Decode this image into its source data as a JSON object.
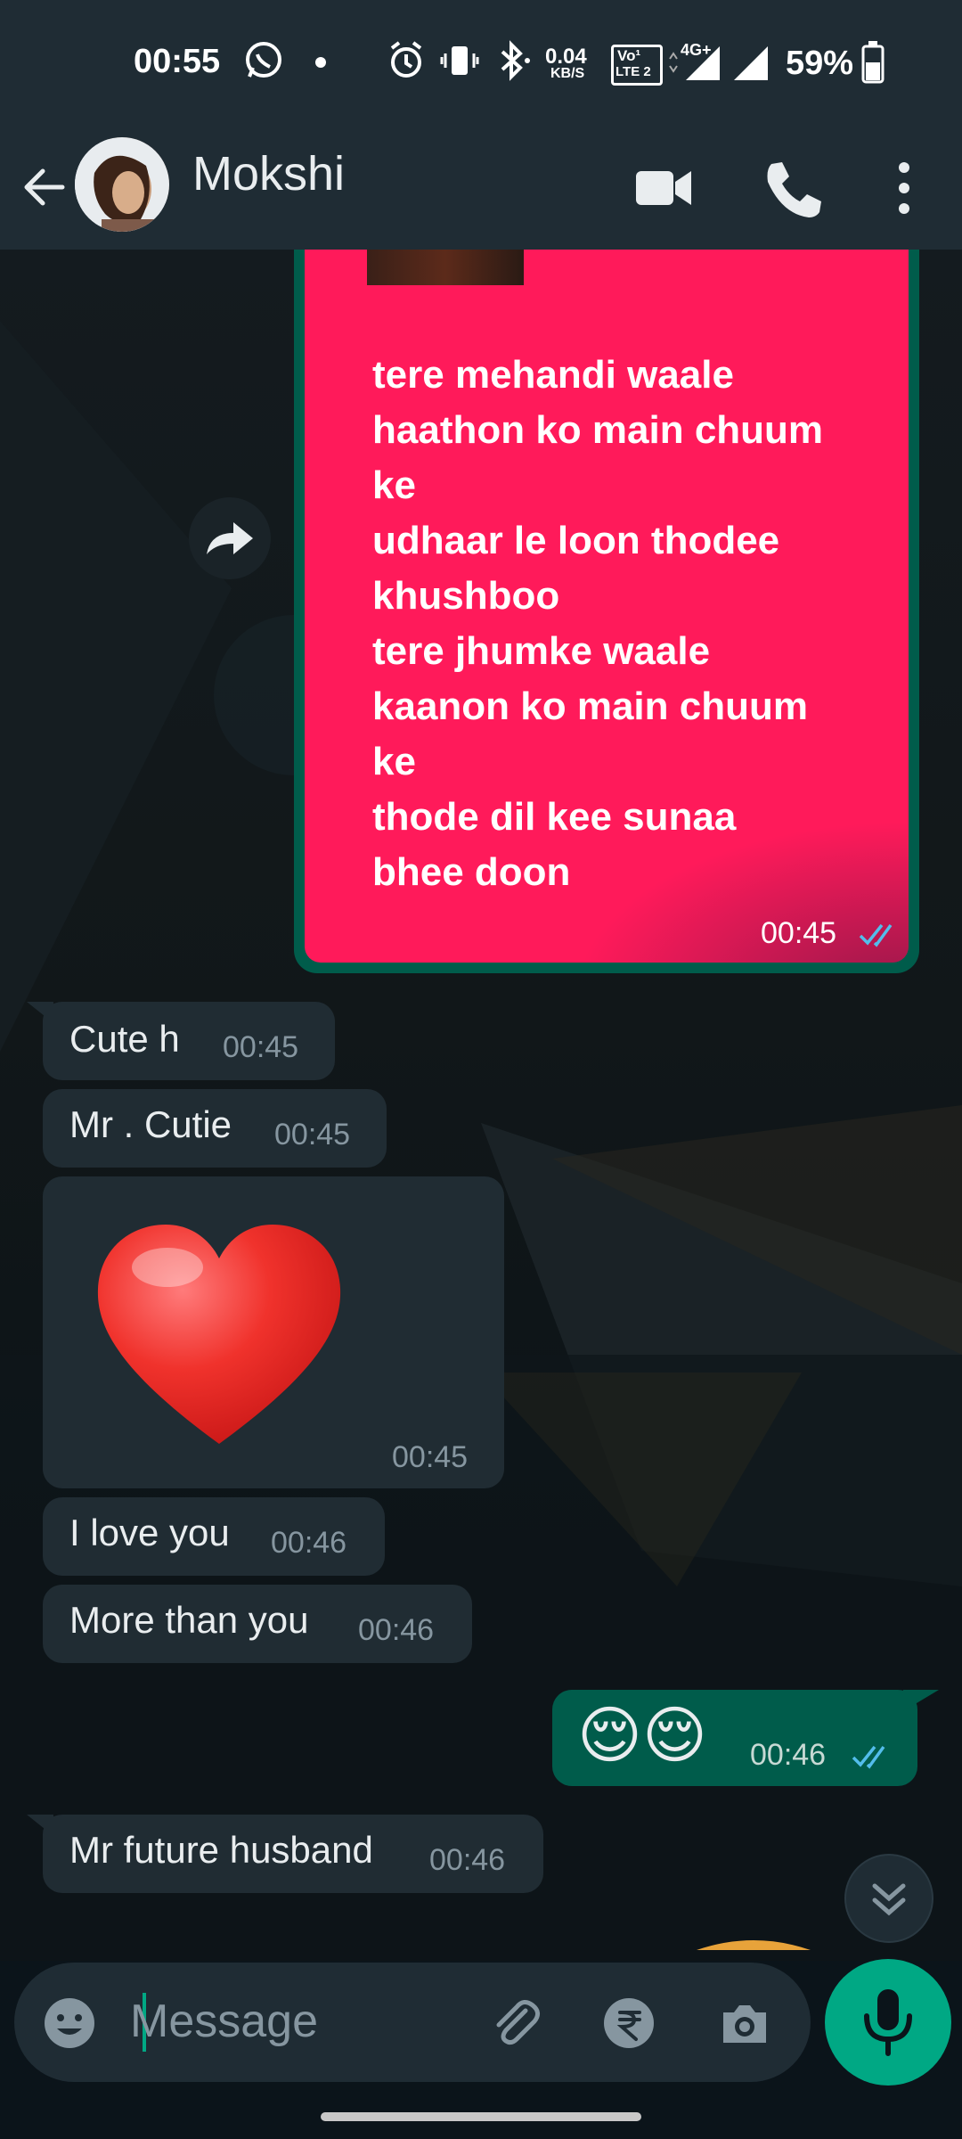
{
  "status_bar": {
    "time": "00:55",
    "net_speed_value": "0.04",
    "net_speed_unit": "KB/S",
    "volte_label": "Vo¹",
    "lte_label": "LTE 2",
    "network_type": "4G+",
    "battery": "59%"
  },
  "header": {
    "contact_name": "Mokshi"
  },
  "media_message": {
    "lyrics": [
      "tere mehandi waale",
      "haathon ko main chuum",
      "ke",
      "udhaar le loon thodee",
      "khushboo",
      "tere jhumke waale",
      "kaanon ko main chuum",
      "ke",
      "thode dil kee sunaa",
      "bhee doon"
    ],
    "time": "00:45",
    "ticks_color": "#53bdeb"
  },
  "messages": [
    {
      "direction": "in",
      "text": "Cute h",
      "time": "00:45"
    },
    {
      "direction": "in",
      "text": "Mr . Cutie",
      "time": "00:45"
    },
    {
      "direction": "in",
      "text": "",
      "emoji": "red-heart",
      "time": "00:45"
    },
    {
      "direction": "in",
      "text": "I love you",
      "time": "00:46"
    },
    {
      "direction": "in",
      "text": "More than you",
      "time": "00:46"
    },
    {
      "direction": "out",
      "text": "😌😌",
      "time": "00:46"
    },
    {
      "direction": "in",
      "text": "Mr future husband",
      "time": "00:46"
    }
  ],
  "input": {
    "placeholder": "Message"
  },
  "colors": {
    "header_bg": "#1f2c34",
    "incoming_bubble": "#202c33",
    "outgoing_bubble": "#005c4b",
    "media_bg": "#ff1a5a",
    "accent": "#00a884",
    "read_ticks": "#53bdeb"
  },
  "icons": {
    "header": [
      "back-arrow-icon",
      "video-call-icon",
      "phone-call-icon",
      "more-vert-icon"
    ],
    "input": [
      "emoji-icon",
      "attach-icon",
      "rupee-payment-icon",
      "camera-icon",
      "mic-icon"
    ]
  }
}
